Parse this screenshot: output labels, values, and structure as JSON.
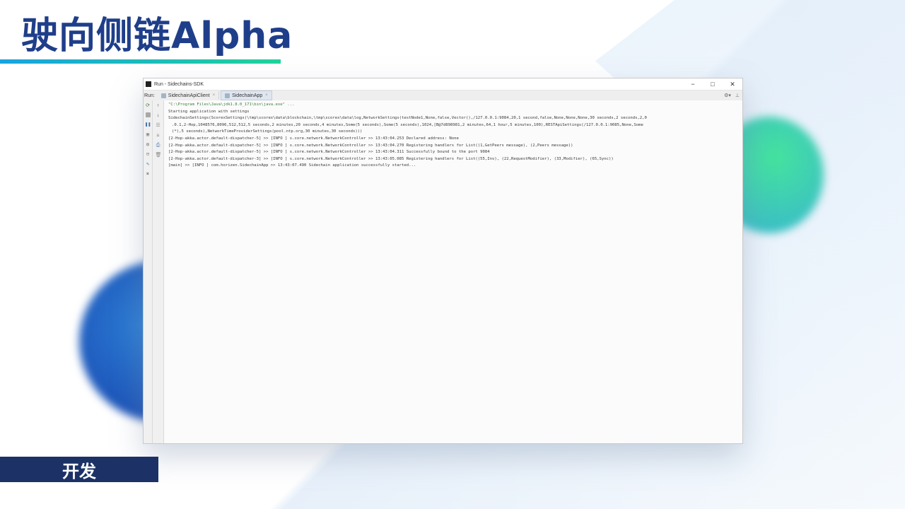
{
  "slide": {
    "title": "驶向侧链Alpha",
    "footer_tag": "开发"
  },
  "window": {
    "title": "Run - Sidechains-SDK",
    "controls": {
      "minimize": "−",
      "maximize": "□",
      "close": "✕"
    },
    "run_label": "Run:",
    "tabs": [
      {
        "label": "SidechainApiClient",
        "active": false
      },
      {
        "label": "SidechainApp",
        "active": true
      }
    ],
    "tab_close": "×",
    "toolbar_right": {
      "settings": "⚙",
      "settings_arrow": "▾",
      "hide": "⊥"
    }
  },
  "console": {
    "lines": [
      "\"C:\\Program Files\\Java\\jdk1.8.0_171\\bin\\java.exe\" ...",
      "Starting application with settings",
      "SidechainSettings(ScorexSettings(\\tmp\\scorex\\data\\blockchain,\\tmp\\scorex\\data\\log,NetworkSettings(testNode1,None,false,Vector(),/127.0.0.1:9084,20,1 second,false,None,None,None,30 seconds,2 seconds,2,0",
      ".0.1,2-Hop,1048576,8096,512,512,5 seconds,2 minutes,20 seconds,4 minutes,Some(5 seconds),Some(5 seconds),1024,[B@7d898981,2 minutes,64,1 hour,5 minutes,100),RESTApiSettings(/127.0.0.1:9085,None,Some",
      "(*),5 seconds),NetworkTimeProviderSettings(pool.ntp.org,30 minutes,30 seconds)))",
      "[2-Hop-akka.actor.default-dispatcher-5] >> [INFO ] s.core.network.NetworkController >> 13:43:04.253 Declared address: None",
      "[2-Hop-akka.actor.default-dispatcher-5] >> [INFO ] s.core.network.NetworkController >> 13:43:04.270 Registering handlers for List((1,GetPeers message), (2,Peers message))",
      "[2-Hop-akka.actor.default-dispatcher-5] >> [INFO ] s.core.network.NetworkController >> 13:43:04.311 Successfully bound to the port 9084",
      "[2-Hop-akka.actor.default-dispatcher-3] >> [INFO ] s.core.network.NetworkController >> 13:43:05.085 Registering handlers for List((55,Inv), (22,RequestModifier), (33,Modifier), (65,Sync))",
      "[main] >> [INFO ] com.horizen.SidechainApp >> 13:43:07.490 Sidechain application successfully started..."
    ]
  },
  "icons": {
    "rerun": "rerun-icon",
    "stop": "stop-icon",
    "pause": "pause-icon",
    "dump": "dump-threads-icon",
    "settings": "settings-icon",
    "exit": "exit-icon",
    "pin": "pin-icon",
    "close": "close-icon",
    "up": "up-arrow-icon",
    "down": "down-arrow-icon",
    "wrap": "soft-wrap-icon",
    "scroll": "scroll-to-end-icon",
    "print": "print-icon",
    "trash": "trash-icon"
  },
  "colors": {
    "title": "#1f3e8a",
    "footer_bg": "#1c3266",
    "command_text": "#3d7f3d"
  }
}
